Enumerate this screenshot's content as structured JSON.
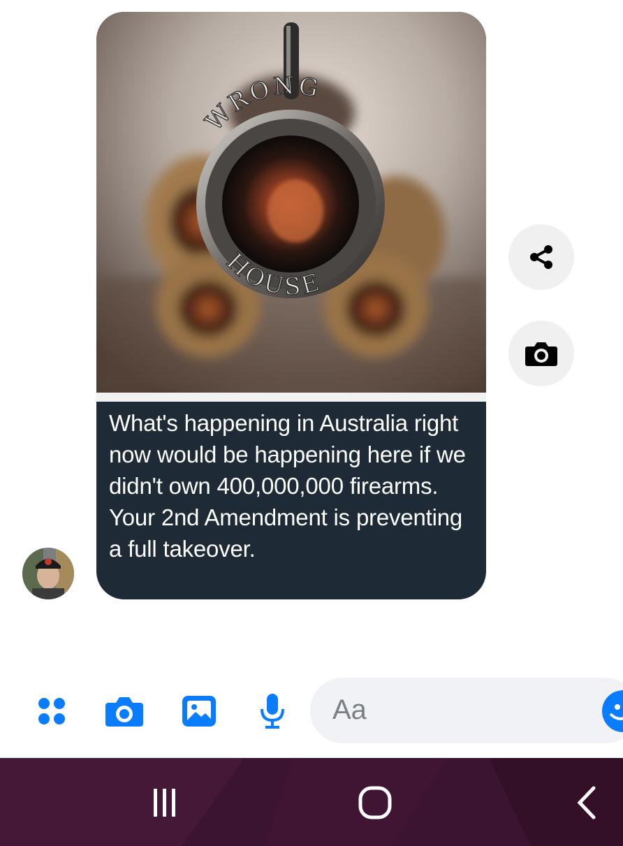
{
  "message": {
    "image_text_top": "WRONG",
    "image_text_bottom": "HOUSE",
    "caption": "What's happening in Australia right now would be happening here if we didn't own 400,000,000 firearms. Your 2nd Amendment is preventing a full takeover."
  },
  "side_actions": {
    "share_icon": "share-icon",
    "camera_icon": "camera-icon"
  },
  "composer": {
    "placeholder": "Aa"
  },
  "colors": {
    "accent": "#0a7cff",
    "bubble": "#1e2b36",
    "navbar": "#3a1430"
  }
}
